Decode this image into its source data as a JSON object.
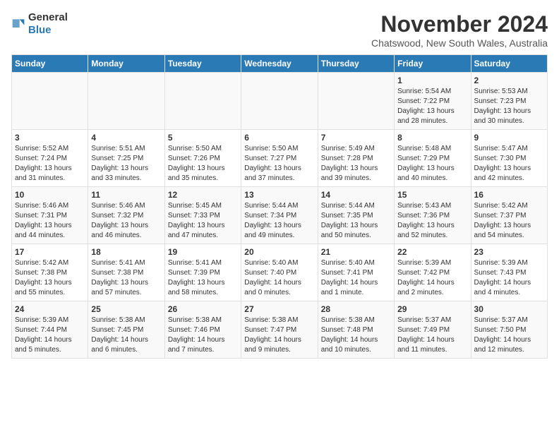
{
  "logo": {
    "general": "General",
    "blue": "Blue"
  },
  "title": "November 2024",
  "location": "Chatswood, New South Wales, Australia",
  "days_of_week": [
    "Sunday",
    "Monday",
    "Tuesday",
    "Wednesday",
    "Thursday",
    "Friday",
    "Saturday"
  ],
  "weeks": [
    {
      "days": [
        {
          "num": "",
          "info": ""
        },
        {
          "num": "",
          "info": ""
        },
        {
          "num": "",
          "info": ""
        },
        {
          "num": "",
          "info": ""
        },
        {
          "num": "",
          "info": ""
        },
        {
          "num": "1",
          "info": "Sunrise: 5:54 AM\nSunset: 7:22 PM\nDaylight: 13 hours\nand 28 minutes."
        },
        {
          "num": "2",
          "info": "Sunrise: 5:53 AM\nSunset: 7:23 PM\nDaylight: 13 hours\nand 30 minutes."
        }
      ]
    },
    {
      "days": [
        {
          "num": "3",
          "info": "Sunrise: 5:52 AM\nSunset: 7:24 PM\nDaylight: 13 hours\nand 31 minutes."
        },
        {
          "num": "4",
          "info": "Sunrise: 5:51 AM\nSunset: 7:25 PM\nDaylight: 13 hours\nand 33 minutes."
        },
        {
          "num": "5",
          "info": "Sunrise: 5:50 AM\nSunset: 7:26 PM\nDaylight: 13 hours\nand 35 minutes."
        },
        {
          "num": "6",
          "info": "Sunrise: 5:50 AM\nSunset: 7:27 PM\nDaylight: 13 hours\nand 37 minutes."
        },
        {
          "num": "7",
          "info": "Sunrise: 5:49 AM\nSunset: 7:28 PM\nDaylight: 13 hours\nand 39 minutes."
        },
        {
          "num": "8",
          "info": "Sunrise: 5:48 AM\nSunset: 7:29 PM\nDaylight: 13 hours\nand 40 minutes."
        },
        {
          "num": "9",
          "info": "Sunrise: 5:47 AM\nSunset: 7:30 PM\nDaylight: 13 hours\nand 42 minutes."
        }
      ]
    },
    {
      "days": [
        {
          "num": "10",
          "info": "Sunrise: 5:46 AM\nSunset: 7:31 PM\nDaylight: 13 hours\nand 44 minutes."
        },
        {
          "num": "11",
          "info": "Sunrise: 5:46 AM\nSunset: 7:32 PM\nDaylight: 13 hours\nand 46 minutes."
        },
        {
          "num": "12",
          "info": "Sunrise: 5:45 AM\nSunset: 7:33 PM\nDaylight: 13 hours\nand 47 minutes."
        },
        {
          "num": "13",
          "info": "Sunrise: 5:44 AM\nSunset: 7:34 PM\nDaylight: 13 hours\nand 49 minutes."
        },
        {
          "num": "14",
          "info": "Sunrise: 5:44 AM\nSunset: 7:35 PM\nDaylight: 13 hours\nand 50 minutes."
        },
        {
          "num": "15",
          "info": "Sunrise: 5:43 AM\nSunset: 7:36 PM\nDaylight: 13 hours\nand 52 minutes."
        },
        {
          "num": "16",
          "info": "Sunrise: 5:42 AM\nSunset: 7:37 PM\nDaylight: 13 hours\nand 54 minutes."
        }
      ]
    },
    {
      "days": [
        {
          "num": "17",
          "info": "Sunrise: 5:42 AM\nSunset: 7:38 PM\nDaylight: 13 hours\nand 55 minutes."
        },
        {
          "num": "18",
          "info": "Sunrise: 5:41 AM\nSunset: 7:38 PM\nDaylight: 13 hours\nand 57 minutes."
        },
        {
          "num": "19",
          "info": "Sunrise: 5:41 AM\nSunset: 7:39 PM\nDaylight: 13 hours\nand 58 minutes."
        },
        {
          "num": "20",
          "info": "Sunrise: 5:40 AM\nSunset: 7:40 PM\nDaylight: 14 hours\nand 0 minutes."
        },
        {
          "num": "21",
          "info": "Sunrise: 5:40 AM\nSunset: 7:41 PM\nDaylight: 14 hours\nand 1 minute."
        },
        {
          "num": "22",
          "info": "Sunrise: 5:39 AM\nSunset: 7:42 PM\nDaylight: 14 hours\nand 2 minutes."
        },
        {
          "num": "23",
          "info": "Sunrise: 5:39 AM\nSunset: 7:43 PM\nDaylight: 14 hours\nand 4 minutes."
        }
      ]
    },
    {
      "days": [
        {
          "num": "24",
          "info": "Sunrise: 5:39 AM\nSunset: 7:44 PM\nDaylight: 14 hours\nand 5 minutes."
        },
        {
          "num": "25",
          "info": "Sunrise: 5:38 AM\nSunset: 7:45 PM\nDaylight: 14 hours\nand 6 minutes."
        },
        {
          "num": "26",
          "info": "Sunrise: 5:38 AM\nSunset: 7:46 PM\nDaylight: 14 hours\nand 7 minutes."
        },
        {
          "num": "27",
          "info": "Sunrise: 5:38 AM\nSunset: 7:47 PM\nDaylight: 14 hours\nand 9 minutes."
        },
        {
          "num": "28",
          "info": "Sunrise: 5:38 AM\nSunset: 7:48 PM\nDaylight: 14 hours\nand 10 minutes."
        },
        {
          "num": "29",
          "info": "Sunrise: 5:37 AM\nSunset: 7:49 PM\nDaylight: 14 hours\nand 11 minutes."
        },
        {
          "num": "30",
          "info": "Sunrise: 5:37 AM\nSunset: 7:50 PM\nDaylight: 14 hours\nand 12 minutes."
        }
      ]
    }
  ]
}
